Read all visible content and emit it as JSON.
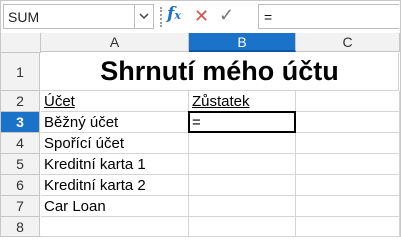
{
  "formula_bar": {
    "name_box": "SUM",
    "formula": "="
  },
  "columns": [
    "A",
    "B",
    "C"
  ],
  "rows": [
    "1",
    "2",
    "3",
    "4",
    "5",
    "6",
    "7",
    "8"
  ],
  "sheet": {
    "title": "Shrnutí mého účtu",
    "header_account": "Účet",
    "header_balance": "Zůstatek",
    "accounts": [
      "Běžný účet",
      "Spořící účet",
      "Kreditní karta 1",
      "Kreditní karta 2",
      "Car Loan"
    ],
    "active_cell_value": "="
  },
  "colors": {
    "selection": "#1a73c8",
    "cancel": "#d9534f",
    "fx": "#1a73c8"
  }
}
